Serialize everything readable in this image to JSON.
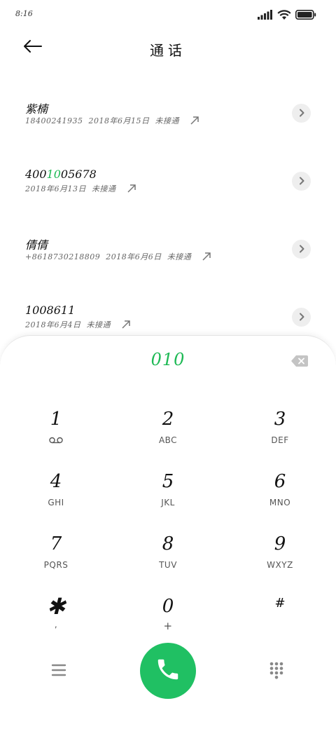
{
  "status": {
    "time": "8:16",
    "icons": [
      "signal-icon",
      "wifi-icon",
      "battery-icon"
    ]
  },
  "header": {
    "title": "通话",
    "back_icon": "arrow-left-icon"
  },
  "calls": [
    {
      "name": "紫楠",
      "number": "18400241935",
      "date": "2018年6月15日",
      "status": "未接通",
      "name_hl_pre": "紫楠",
      "name_hl": "",
      "name_hl_post": ""
    },
    {
      "name": "4001005678",
      "number": "",
      "date": "2018年6月13日",
      "status": "未接通",
      "name_hl_pre": "400",
      "name_hl": "10",
      "name_hl_post": "05678"
    },
    {
      "name": "倩倩",
      "number": "+8618730218809",
      "date": "2018年6月6日",
      "status": "未接通",
      "name_hl_pre": "倩倩",
      "name_hl": "",
      "name_hl_post": ""
    },
    {
      "name": "1008611",
      "number": "",
      "date": "2018年6月4日",
      "status": "未接通",
      "name_hl_pre": "1008611",
      "name_hl": "",
      "name_hl_post": ""
    }
  ],
  "dialer": {
    "input": "010",
    "accent_color": "#1db954",
    "keys": [
      [
        {
          "digit": "1",
          "letters": "",
          "icon": "voicemail-icon"
        },
        {
          "digit": "2",
          "letters": "ABC"
        },
        {
          "digit": "3",
          "letters": "DEF"
        }
      ],
      [
        {
          "digit": "4",
          "letters": "GHI"
        },
        {
          "digit": "5",
          "letters": "JKL"
        },
        {
          "digit": "6",
          "letters": "MNO"
        }
      ],
      [
        {
          "digit": "7",
          "letters": "PQRS"
        },
        {
          "digit": "8",
          "letters": "TUV"
        },
        {
          "digit": "9",
          "letters": "WXYZ"
        }
      ],
      [
        {
          "digit": "✱",
          "letters": ","
        },
        {
          "digit": "0",
          "letters": "+"
        },
        {
          "digit": "#",
          "letters": ""
        }
      ]
    ],
    "call_color": "#20c063"
  }
}
